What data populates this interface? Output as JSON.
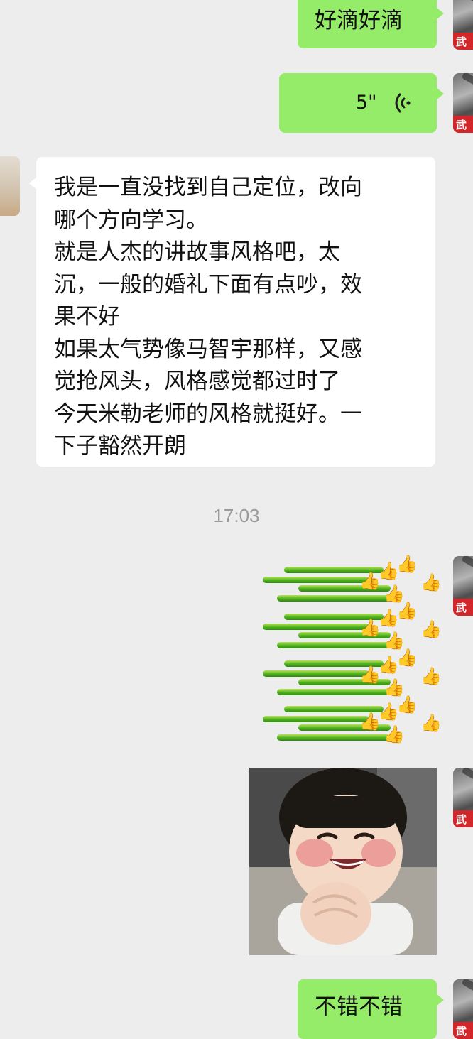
{
  "messages": {
    "out_top_text": "好滴好滴",
    "voice_duration": "5\"",
    "incoming_lines": [
      "我是一直没找到自己定位，改向",
      "哪个方向学习。",
      "就是人杰的讲故事风格吧，太",
      "沉，一般的婚礼下面有点吵，效",
      "果不好",
      "如果太气势像马智宇那样，又感",
      "觉抢风头，风格感觉都过时了",
      "今天米勒老师的风格就挺好。一",
      "下子豁然开朗"
    ],
    "timestamp": "17:03",
    "out_bottom_text": "不错不错"
  },
  "avatar": {
    "self_stamp": "武"
  },
  "sticker": {
    "thumb_glyph": "👍"
  },
  "colors": {
    "background": "#ededed",
    "outgoing_bubble": "#95ec69",
    "incoming_bubble": "#ffffff",
    "timestamp": "#9a9a9a"
  }
}
